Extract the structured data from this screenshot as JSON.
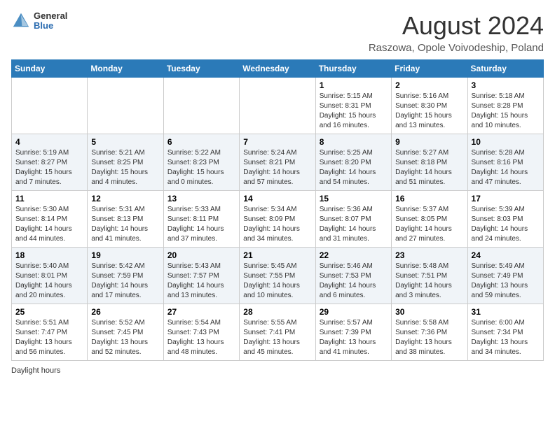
{
  "header": {
    "logo_general": "General",
    "logo_blue": "Blue",
    "main_title": "August 2024",
    "subtitle": "Raszowa, Opole Voivodeship, Poland"
  },
  "days_of_week": [
    "Sunday",
    "Monday",
    "Tuesday",
    "Wednesday",
    "Thursday",
    "Friday",
    "Saturday"
  ],
  "weeks": [
    [
      {
        "day": "",
        "sunrise": "",
        "sunset": "",
        "daylight": ""
      },
      {
        "day": "",
        "sunrise": "",
        "sunset": "",
        "daylight": ""
      },
      {
        "day": "",
        "sunrise": "",
        "sunset": "",
        "daylight": ""
      },
      {
        "day": "",
        "sunrise": "",
        "sunset": "",
        "daylight": ""
      },
      {
        "day": "1",
        "sunrise": "Sunrise: 5:15 AM",
        "sunset": "Sunset: 8:31 PM",
        "daylight": "Daylight: 15 hours and 16 minutes."
      },
      {
        "day": "2",
        "sunrise": "Sunrise: 5:16 AM",
        "sunset": "Sunset: 8:30 PM",
        "daylight": "Daylight: 15 hours and 13 minutes."
      },
      {
        "day": "3",
        "sunrise": "Sunrise: 5:18 AM",
        "sunset": "Sunset: 8:28 PM",
        "daylight": "Daylight: 15 hours and 10 minutes."
      }
    ],
    [
      {
        "day": "4",
        "sunrise": "Sunrise: 5:19 AM",
        "sunset": "Sunset: 8:27 PM",
        "daylight": "Daylight: 15 hours and 7 minutes."
      },
      {
        "day": "5",
        "sunrise": "Sunrise: 5:21 AM",
        "sunset": "Sunset: 8:25 PM",
        "daylight": "Daylight: 15 hours and 4 minutes."
      },
      {
        "day": "6",
        "sunrise": "Sunrise: 5:22 AM",
        "sunset": "Sunset: 8:23 PM",
        "daylight": "Daylight: 15 hours and 0 minutes."
      },
      {
        "day": "7",
        "sunrise": "Sunrise: 5:24 AM",
        "sunset": "Sunset: 8:21 PM",
        "daylight": "Daylight: 14 hours and 57 minutes."
      },
      {
        "day": "8",
        "sunrise": "Sunrise: 5:25 AM",
        "sunset": "Sunset: 8:20 PM",
        "daylight": "Daylight: 14 hours and 54 minutes."
      },
      {
        "day": "9",
        "sunrise": "Sunrise: 5:27 AM",
        "sunset": "Sunset: 8:18 PM",
        "daylight": "Daylight: 14 hours and 51 minutes."
      },
      {
        "day": "10",
        "sunrise": "Sunrise: 5:28 AM",
        "sunset": "Sunset: 8:16 PM",
        "daylight": "Daylight: 14 hours and 47 minutes."
      }
    ],
    [
      {
        "day": "11",
        "sunrise": "Sunrise: 5:30 AM",
        "sunset": "Sunset: 8:14 PM",
        "daylight": "Daylight: 14 hours and 44 minutes."
      },
      {
        "day": "12",
        "sunrise": "Sunrise: 5:31 AM",
        "sunset": "Sunset: 8:13 PM",
        "daylight": "Daylight: 14 hours and 41 minutes."
      },
      {
        "day": "13",
        "sunrise": "Sunrise: 5:33 AM",
        "sunset": "Sunset: 8:11 PM",
        "daylight": "Daylight: 14 hours and 37 minutes."
      },
      {
        "day": "14",
        "sunrise": "Sunrise: 5:34 AM",
        "sunset": "Sunset: 8:09 PM",
        "daylight": "Daylight: 14 hours and 34 minutes."
      },
      {
        "day": "15",
        "sunrise": "Sunrise: 5:36 AM",
        "sunset": "Sunset: 8:07 PM",
        "daylight": "Daylight: 14 hours and 31 minutes."
      },
      {
        "day": "16",
        "sunrise": "Sunrise: 5:37 AM",
        "sunset": "Sunset: 8:05 PM",
        "daylight": "Daylight: 14 hours and 27 minutes."
      },
      {
        "day": "17",
        "sunrise": "Sunrise: 5:39 AM",
        "sunset": "Sunset: 8:03 PM",
        "daylight": "Daylight: 14 hours and 24 minutes."
      }
    ],
    [
      {
        "day": "18",
        "sunrise": "Sunrise: 5:40 AM",
        "sunset": "Sunset: 8:01 PM",
        "daylight": "Daylight: 14 hours and 20 minutes."
      },
      {
        "day": "19",
        "sunrise": "Sunrise: 5:42 AM",
        "sunset": "Sunset: 7:59 PM",
        "daylight": "Daylight: 14 hours and 17 minutes."
      },
      {
        "day": "20",
        "sunrise": "Sunrise: 5:43 AM",
        "sunset": "Sunset: 7:57 PM",
        "daylight": "Daylight: 14 hours and 13 minutes."
      },
      {
        "day": "21",
        "sunrise": "Sunrise: 5:45 AM",
        "sunset": "Sunset: 7:55 PM",
        "daylight": "Daylight: 14 hours and 10 minutes."
      },
      {
        "day": "22",
        "sunrise": "Sunrise: 5:46 AM",
        "sunset": "Sunset: 7:53 PM",
        "daylight": "Daylight: 14 hours and 6 minutes."
      },
      {
        "day": "23",
        "sunrise": "Sunrise: 5:48 AM",
        "sunset": "Sunset: 7:51 PM",
        "daylight": "Daylight: 14 hours and 3 minutes."
      },
      {
        "day": "24",
        "sunrise": "Sunrise: 5:49 AM",
        "sunset": "Sunset: 7:49 PM",
        "daylight": "Daylight: 13 hours and 59 minutes."
      }
    ],
    [
      {
        "day": "25",
        "sunrise": "Sunrise: 5:51 AM",
        "sunset": "Sunset: 7:47 PM",
        "daylight": "Daylight: 13 hours and 56 minutes."
      },
      {
        "day": "26",
        "sunrise": "Sunrise: 5:52 AM",
        "sunset": "Sunset: 7:45 PM",
        "daylight": "Daylight: 13 hours and 52 minutes."
      },
      {
        "day": "27",
        "sunrise": "Sunrise: 5:54 AM",
        "sunset": "Sunset: 7:43 PM",
        "daylight": "Daylight: 13 hours and 48 minutes."
      },
      {
        "day": "28",
        "sunrise": "Sunrise: 5:55 AM",
        "sunset": "Sunset: 7:41 PM",
        "daylight": "Daylight: 13 hours and 45 minutes."
      },
      {
        "day": "29",
        "sunrise": "Sunrise: 5:57 AM",
        "sunset": "Sunset: 7:39 PM",
        "daylight": "Daylight: 13 hours and 41 minutes."
      },
      {
        "day": "30",
        "sunrise": "Sunrise: 5:58 AM",
        "sunset": "Sunset: 7:36 PM",
        "daylight": "Daylight: 13 hours and 38 minutes."
      },
      {
        "day": "31",
        "sunrise": "Sunrise: 6:00 AM",
        "sunset": "Sunset: 7:34 PM",
        "daylight": "Daylight: 13 hours and 34 minutes."
      }
    ]
  ],
  "footer": {
    "daylight_hours": "Daylight hours"
  }
}
